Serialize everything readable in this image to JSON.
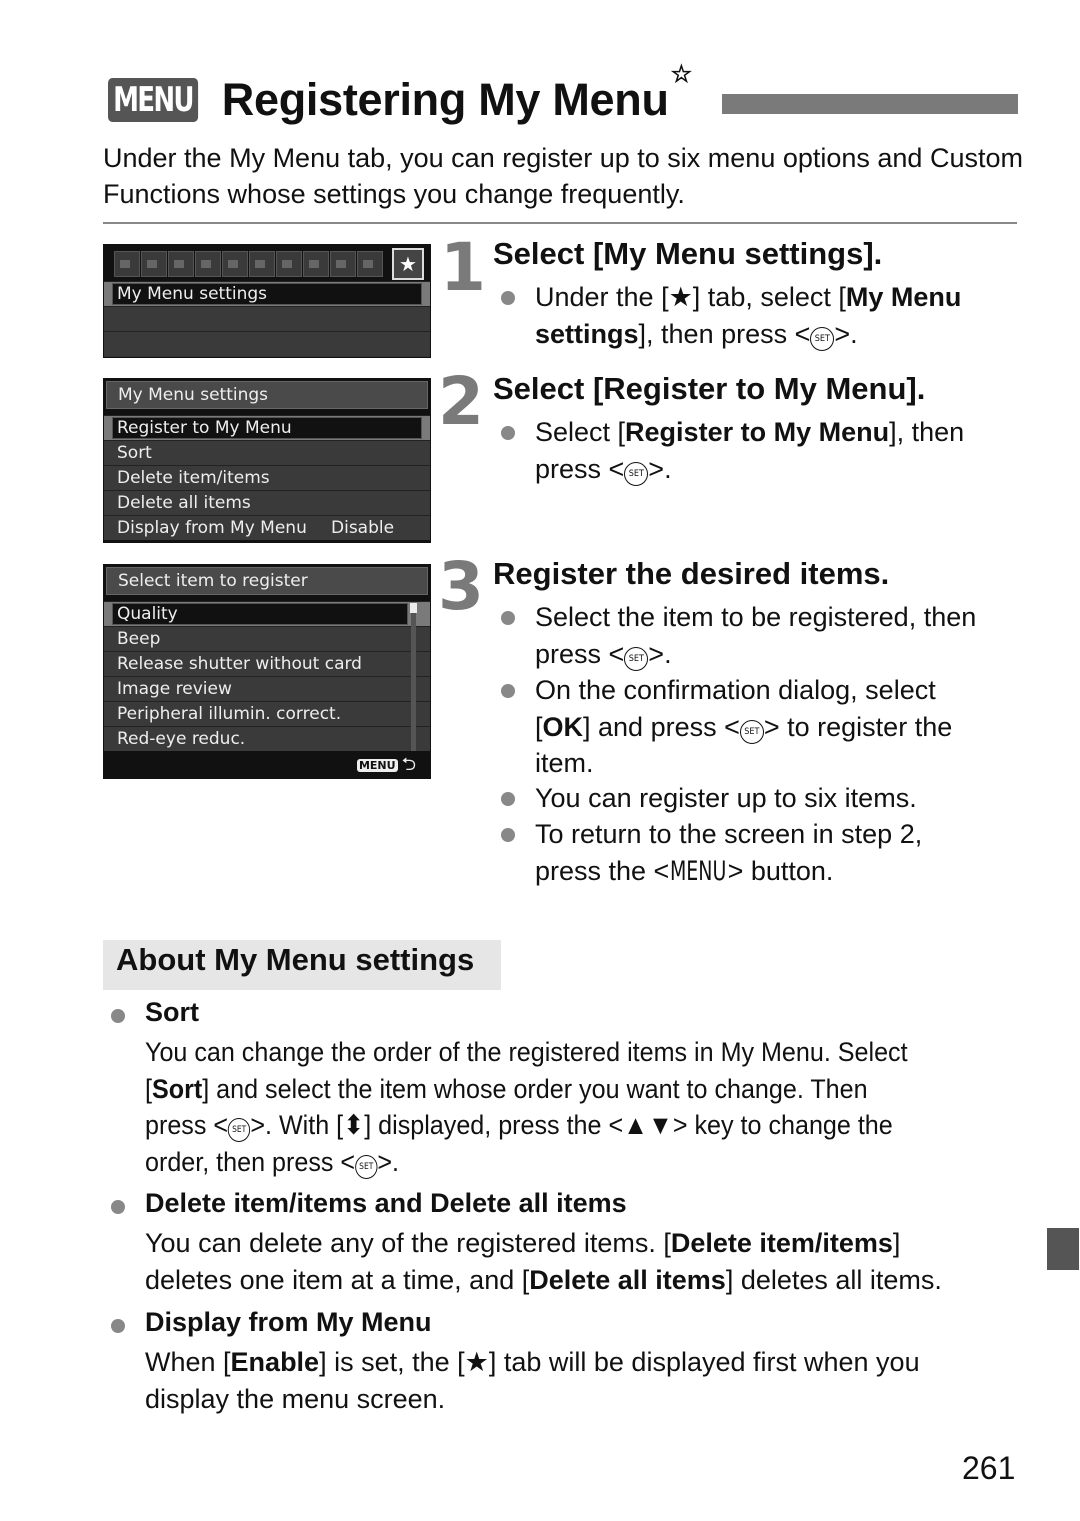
{
  "header": {
    "menu_badge": "MENU",
    "title": "Registering My Menu",
    "title_star": "☆",
    "intro": "Under the My Menu tab, you can register up to six menu options and Custom Functions whose settings you change frequently."
  },
  "screens": {
    "screen1": {
      "tab_icons": [
        "shooting-1",
        "shooting-2",
        "shooting-3",
        "shooting-4",
        "playback-1",
        "playback-2",
        "setup-1",
        "setup-2",
        "setup-3",
        "custom-functions",
        "my-menu-star"
      ],
      "active_tab": "★",
      "items": [
        "My Menu settings",
        "",
        ""
      ]
    },
    "screen2": {
      "header": "My Menu settings",
      "items": [
        {
          "label": "Register to My Menu",
          "value": ""
        },
        {
          "label": "Sort",
          "value": ""
        },
        {
          "label": "Delete item/items",
          "value": ""
        },
        {
          "label": "Delete all items",
          "value": ""
        },
        {
          "label": "Display from My Menu",
          "value": "Disable"
        }
      ]
    },
    "screen3": {
      "header": "Select item to register",
      "items": [
        "Quality",
        "Beep",
        "Release shutter without card",
        "Image review",
        "Peripheral illumin. correct.",
        "Red-eye reduc."
      ],
      "footer_menu": "MENU",
      "footer_back": "⮌"
    }
  },
  "steps": [
    {
      "number": "1",
      "title": "Select [My Menu settings].",
      "bullets": [
        {
          "l1a": "Under the [",
          "star": "★",
          "l1b": "] tab, select [",
          "bold1": "My Menu",
          "l2bold": "settings",
          "l2": "], then press <",
          "set": "SET",
          "end": ">."
        }
      ]
    },
    {
      "number": "2",
      "title": "Select [Register to My Menu].",
      "bullets": [
        {
          "a": "Select [",
          "bold": "Register to My Menu",
          "b": "], then",
          "l2": "press <",
          "set": "SET",
          "end": ">."
        }
      ]
    },
    {
      "number": "3",
      "title": "Register the desired items.",
      "bullets": [
        {
          "l1": "Select the item to be registered, then",
          "l2": "press <",
          "set": "SET",
          "end": ">."
        },
        {
          "l1": "On the confirmation dialog, select",
          "l2a": "[",
          "bold": "OK",
          "l2b": "] and press <",
          "set": "SET",
          "l2c": "> to register the",
          "l3": "item."
        },
        {
          "l1": "You can register up to six items."
        },
        {
          "l1": "To return to the screen in step 2,",
          "l2a": "press the <",
          "menu": "MENU",
          "l2b": "> button."
        }
      ]
    }
  ],
  "about": {
    "title": "About My Menu settings",
    "sections": [
      {
        "heading": "Sort",
        "l1": "You can change the order of the registered items in My Menu. Select",
        "l2a": "[",
        "l2bold": "Sort",
        "l2b": "] and select the item whose order you want to change. Then",
        "l3a": "press <",
        "set": "SET",
        "l3b": ">. With [",
        "updown": "⬍",
        "l3c": "] displayed, press the <",
        "keys": "▲▼",
        "l3d": "> key to change the",
        "l4a": "order, then press <",
        "l4b": ">."
      },
      {
        "heading": "Delete item/items and Delete all items",
        "l1a": "You can delete any of the registered items. [",
        "l1bold": "Delete item/items",
        "l1b": "]",
        "l2a": "deletes one item at a time, and [",
        "l2bold": "Delete all items",
        "l2b": "] deletes all items."
      },
      {
        "heading": "Display from My Menu",
        "l1a": "When [",
        "l1bold": "Enable",
        "l1b": "] is set, the [",
        "star": "★",
        "l1c": "] tab will be displayed first when you",
        "l2": "display the menu screen."
      }
    ]
  },
  "page_number": "261"
}
